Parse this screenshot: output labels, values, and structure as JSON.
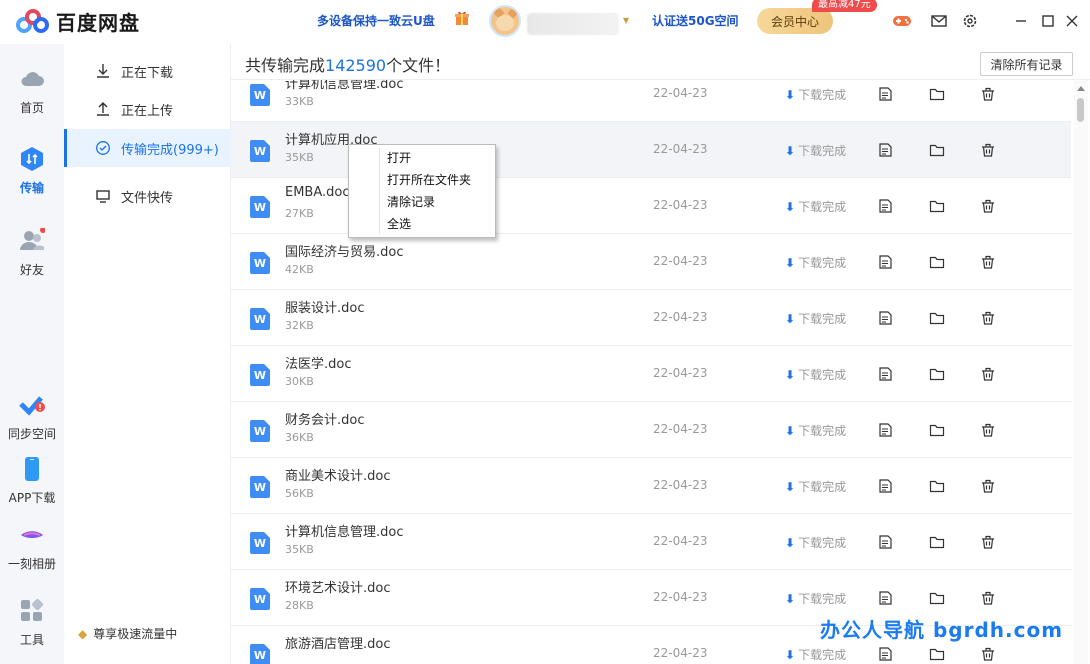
{
  "app": {
    "title": "百度网盘"
  },
  "titlebar": {
    "promo": "多设备保持一致云U盘",
    "verify": "认证送50G空间",
    "member_center": "会员中心",
    "member_tag": "最高减47元"
  },
  "leftnav": {
    "items": [
      {
        "label": "首页",
        "icon": "cloud-icon"
      },
      {
        "label": "传输",
        "icon": "transfer-icon",
        "active": true
      },
      {
        "label": "好友",
        "icon": "friends-icon"
      },
      {
        "label": "同步空间",
        "icon": "sync-icon"
      },
      {
        "label": "APP下载",
        "icon": "phone-icon"
      },
      {
        "label": "一刻相册",
        "icon": "album-icon"
      },
      {
        "label": "工具",
        "icon": "tools-icon"
      }
    ]
  },
  "subnav": {
    "items": [
      {
        "label": "正在下载",
        "icon": "download-icon"
      },
      {
        "label": "正在上传",
        "icon": "upload-icon"
      },
      {
        "label": "传输完成(999+)",
        "icon": "check-circle-icon",
        "active": true
      },
      {
        "label": "文件快传",
        "icon": "monitor-icon"
      }
    ],
    "speed": "尊享极速流量中"
  },
  "main": {
    "summary_prefix": "共传输完成",
    "summary_count": "142590",
    "summary_suffix": "个文件！",
    "clear_all": "清除所有记录"
  },
  "files": [
    {
      "name": "计算机信息管理.doc",
      "size": "33KB",
      "date": "22-04-23",
      "status": "下载完成"
    },
    {
      "name": "计算机应用.doc",
      "size": "35KB",
      "date": "22-04-23",
      "status": "下载完成"
    },
    {
      "name": "EMBA.doc",
      "size": "27KB",
      "date": "22-04-23",
      "status": "下载完成"
    },
    {
      "name": "国际经济与贸易.doc",
      "size": "42KB",
      "date": "22-04-23",
      "status": "下载完成"
    },
    {
      "name": "服装设计.doc",
      "size": "32KB",
      "date": "22-04-23",
      "status": "下载完成"
    },
    {
      "name": "法医学.doc",
      "size": "30KB",
      "date": "22-04-23",
      "status": "下载完成"
    },
    {
      "name": "财务会计.doc",
      "size": "36KB",
      "date": "22-04-23",
      "status": "下载完成"
    },
    {
      "name": "商业美术设计.doc",
      "size": "56KB",
      "date": "22-04-23",
      "status": "下载完成"
    },
    {
      "name": "计算机信息管理.doc",
      "size": "35KB",
      "date": "22-04-23",
      "status": "下载完成"
    },
    {
      "name": "环境艺术设计.doc",
      "size": "28KB",
      "date": "22-04-23",
      "status": "下载完成"
    },
    {
      "name": "旅游酒店管理.doc",
      "size": "",
      "date": "22-04-23",
      "status": "下载完成"
    }
  ],
  "file_icon_letter": "W",
  "context_menu": {
    "items": [
      "打开",
      "打开所在文件夹",
      "清除记录",
      "全选"
    ]
  },
  "watermark": "办公人导航 bgrdh.com",
  "colors": {
    "accent": "#1a73e8",
    "doc": "#3e8cf4"
  }
}
